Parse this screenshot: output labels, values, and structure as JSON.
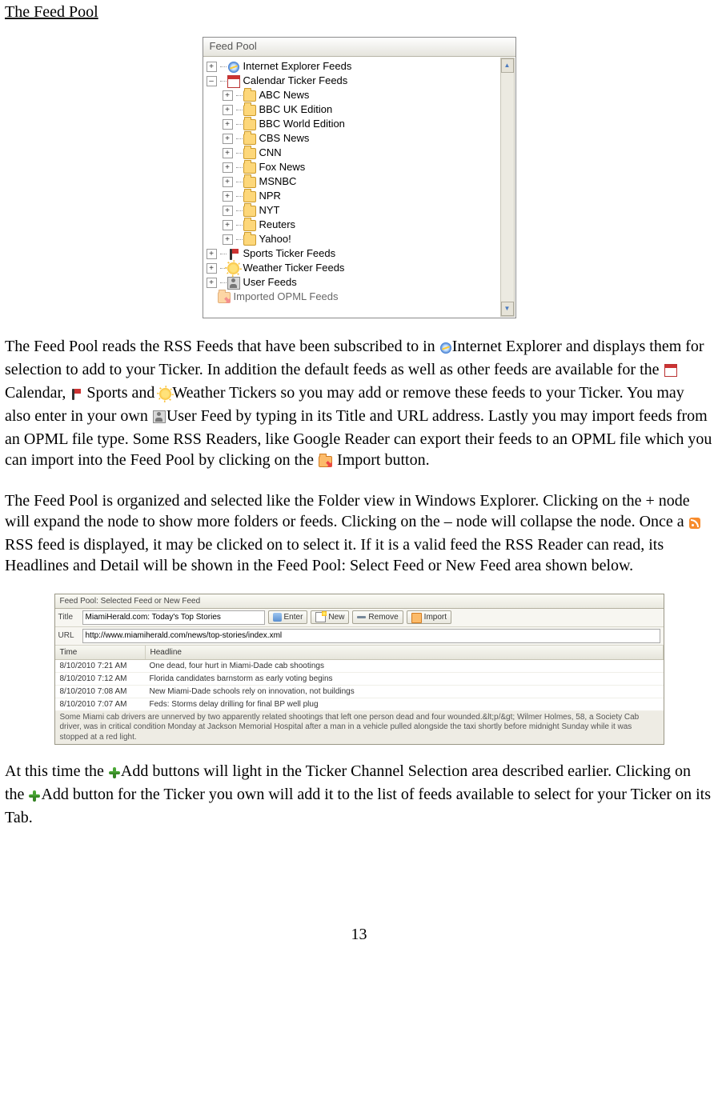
{
  "page": {
    "title": "The Feed Pool",
    "number": "13"
  },
  "feedPool": {
    "panelTitle": "Feed Pool",
    "topNodes": {
      "ie": "Internet Explorer Feeds",
      "calendar": "Calendar Ticker Feeds",
      "sports": "Sports Ticker Feeds",
      "weather": "Weather Ticker Feeds",
      "user": "User Feeds",
      "imported": "Imported OPML Feeds"
    },
    "calendarChildren": [
      "ABC News",
      "BBC UK Edition",
      "BBC World Edition",
      "CBS News",
      "CNN",
      "Fox News",
      "MSNBC",
      "NPR",
      "NYT",
      "Reuters",
      "Yahoo!"
    ]
  },
  "para1": {
    "t1": "The Feed Pool reads the RSS Feeds that have been subscribed to in ",
    "t2": "Internet Explorer and displays them for selection to add to your Ticker. In addition the default feeds as well as other feeds are available for the ",
    "t3": "Calendar, ",
    "t4": " Sports and ",
    "t5": "Weather Tickers so you may add or remove these feeds to your Ticker. You may also enter in your own ",
    "t6": "User Feed by typing in its Title and URL address. Lastly you may import feeds from an OPML file type. Some RSS Readers, like Google Reader can export their feeds to an OPML file which you can import into the Feed Pool by clicking on the ",
    "t7": " Import button."
  },
  "para2": {
    "t1": "The Feed Pool is organized and selected like the Folder view in Windows Explorer. Clicking on the + node will expand the node to show more folders or feeds. Clicking on the – node will collapse the node. Once a ",
    "t2": "  RSS feed is displayed, it may be clicked on to select it. If it is a valid feed the RSS Reader can read, its Headlines and Detail will be shown in the Feed Pool: Select Feed or New Feed area shown below."
  },
  "selectedFeed": {
    "panelTitle": "Feed Pool: Selected Feed or New Feed",
    "labels": {
      "title": "Title",
      "url": "URL"
    },
    "values": {
      "title": "MiamiHerald.com: Today's Top Stories",
      "url": "http://www.miamiherald.com/news/top-stories/index.xml"
    },
    "buttons": {
      "enter": "Enter",
      "new": "New",
      "remove": "Remove",
      "import": "Import"
    },
    "columns": {
      "time": "Time",
      "headline": "Headline"
    },
    "rows": [
      {
        "time": "8/10/2010 7:21 AM",
        "headline": "One dead, four hurt in Miami-Dade cab shootings"
      },
      {
        "time": "8/10/2010 7:12 AM",
        "headline": "Florida candidates barnstorm as early voting begins"
      },
      {
        "time": "8/10/2010 7:08 AM",
        "headline": "New Miami-Dade schools rely on innovation, not buildings"
      },
      {
        "time": "8/10/2010 7:07 AM",
        "headline": "Feds: Storms delay drilling for final BP well plug"
      }
    ],
    "detail": "Some Miami cab drivers are unnerved by two apparently related shootings that left one person dead and four wounded.&lt;p/&gt; Wilmer Holmes, 58, a Society Cab driver, was in critical condition Monday at Jackson Memorial Hospital after a man in a vehicle pulled alongside the taxi shortly before midnight Sunday while it was stopped at a red light."
  },
  "para3": {
    "t1": "At this time the ",
    "t2": "Add buttons will light in the Ticker Channel Selection area described earlier. Clicking on the ",
    "t3": "Add button for the Ticker you own will add it to the list of feeds available to select for your Ticker on its Tab."
  }
}
